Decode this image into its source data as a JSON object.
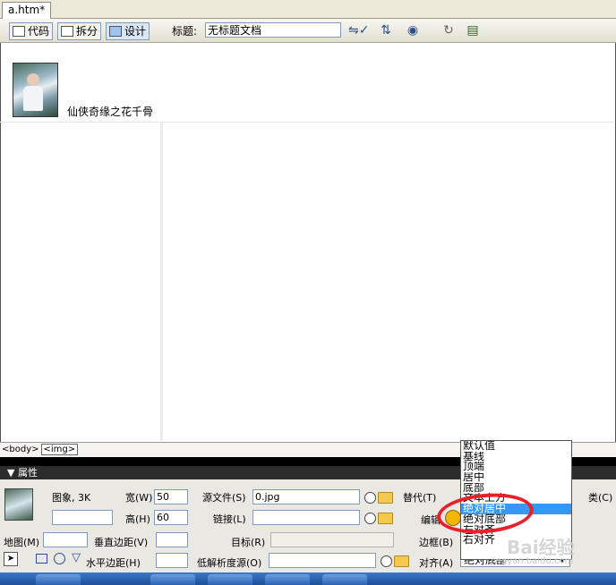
{
  "tab": {
    "label": "a.htm*"
  },
  "toolbar": {
    "code_label": "代码",
    "split_label": "拆分",
    "design_label": "设计",
    "title_label": "标题:",
    "title_value": "无标题文档"
  },
  "design": {
    "caption": "仙侠奇缘之花千骨"
  },
  "tag_selector": {
    "tags": [
      "<body>",
      "<img>"
    ]
  },
  "properties": {
    "header": "▼ 属性",
    "image_label": "图象, 3K",
    "width_label": "宽(W)",
    "width_value": "50",
    "height_label": "高(H)",
    "height_value": "60",
    "src_label": "源文件(S)",
    "src_value": "0.jpg",
    "link_label": "链接(L)",
    "link_value": "",
    "alt_label": "替代(T)",
    "edit_label": "编辑",
    "class_label": "类(C)",
    "map_label": "地图(M)",
    "vspace_label": "垂直边距(V)",
    "hspace_label": "水平边距(H)",
    "target_label": "目标(R)",
    "lowsrc_label": "低解析度源(O)",
    "border_label": "边框(B)",
    "align_label": "对齐(A)",
    "align_value": "绝对底部"
  },
  "align_options": [
    "默认值",
    "基线",
    "顶端",
    "居中",
    "底部",
    "文本上方",
    "绝对居中",
    "绝对底部",
    "左对齐",
    "右对齐"
  ],
  "align_highlight_index": 6,
  "watermark": {
    "text": "Bai经验",
    "url": "jingyan.baidu.com"
  },
  "colors": {
    "highlight": "#3399ff",
    "annotation": "#e8202a"
  }
}
